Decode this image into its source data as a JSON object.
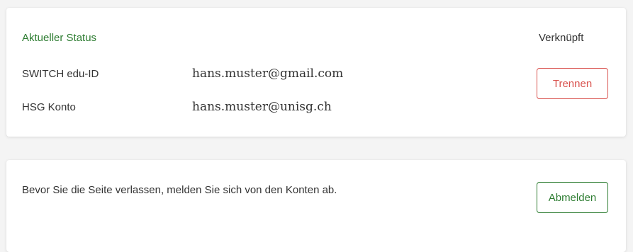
{
  "status": {
    "title": "Aktueller Status",
    "linked_label": "Verknüpft",
    "rows": [
      {
        "label": "SWITCH edu-ID",
        "value": "hans.muster@gmail.com"
      },
      {
        "label": "HSG Konto",
        "value": "hans.muster@unisg.ch"
      }
    ],
    "disconnect_label": "Trennen"
  },
  "logout": {
    "message": "Bevor Sie die Seite verlassen, melden Sie sich von den Konten ab.",
    "button_label": "Abmelden"
  },
  "colors": {
    "accent_green": "#2e7d32",
    "danger_red": "#d9534f",
    "text": "#333333",
    "background": "#f4f4f4",
    "card": "#ffffff"
  }
}
